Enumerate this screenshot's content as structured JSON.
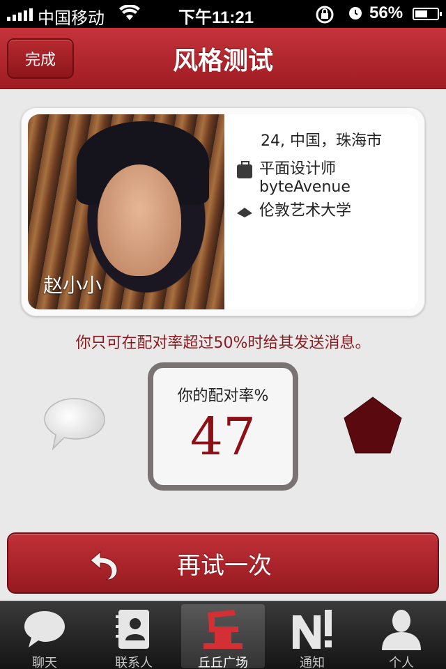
{
  "status_bar": {
    "carrier": "中国移动",
    "time": "下午11:21",
    "battery": "56%"
  },
  "nav": {
    "done_label": "完成",
    "title": "风格测试"
  },
  "profile": {
    "name": "赵小小",
    "location": "24, 中国，珠海市",
    "job": "平面设计师",
    "company": "byteAvenue",
    "school": "伦敦艺术大学"
  },
  "notice": "你只可在配对率超过50%时给其发送消息。",
  "match": {
    "label": "你的配对率%",
    "value": "47"
  },
  "retry": {
    "label": "再试一次"
  },
  "tabs": [
    {
      "label": "聊天",
      "icon": "chat-icon"
    },
    {
      "label": "联系人",
      "icon": "contacts-icon"
    },
    {
      "label": "丘丘广场",
      "icon": "qiu-plaza-icon",
      "active": true
    },
    {
      "label": "通知",
      "icon": "notification-icon"
    },
    {
      "label": "个人",
      "icon": "person-icon"
    }
  ],
  "colors": {
    "accent": "#a5222a",
    "score": "#8c1015",
    "pentagon": "#5a0a0e"
  }
}
